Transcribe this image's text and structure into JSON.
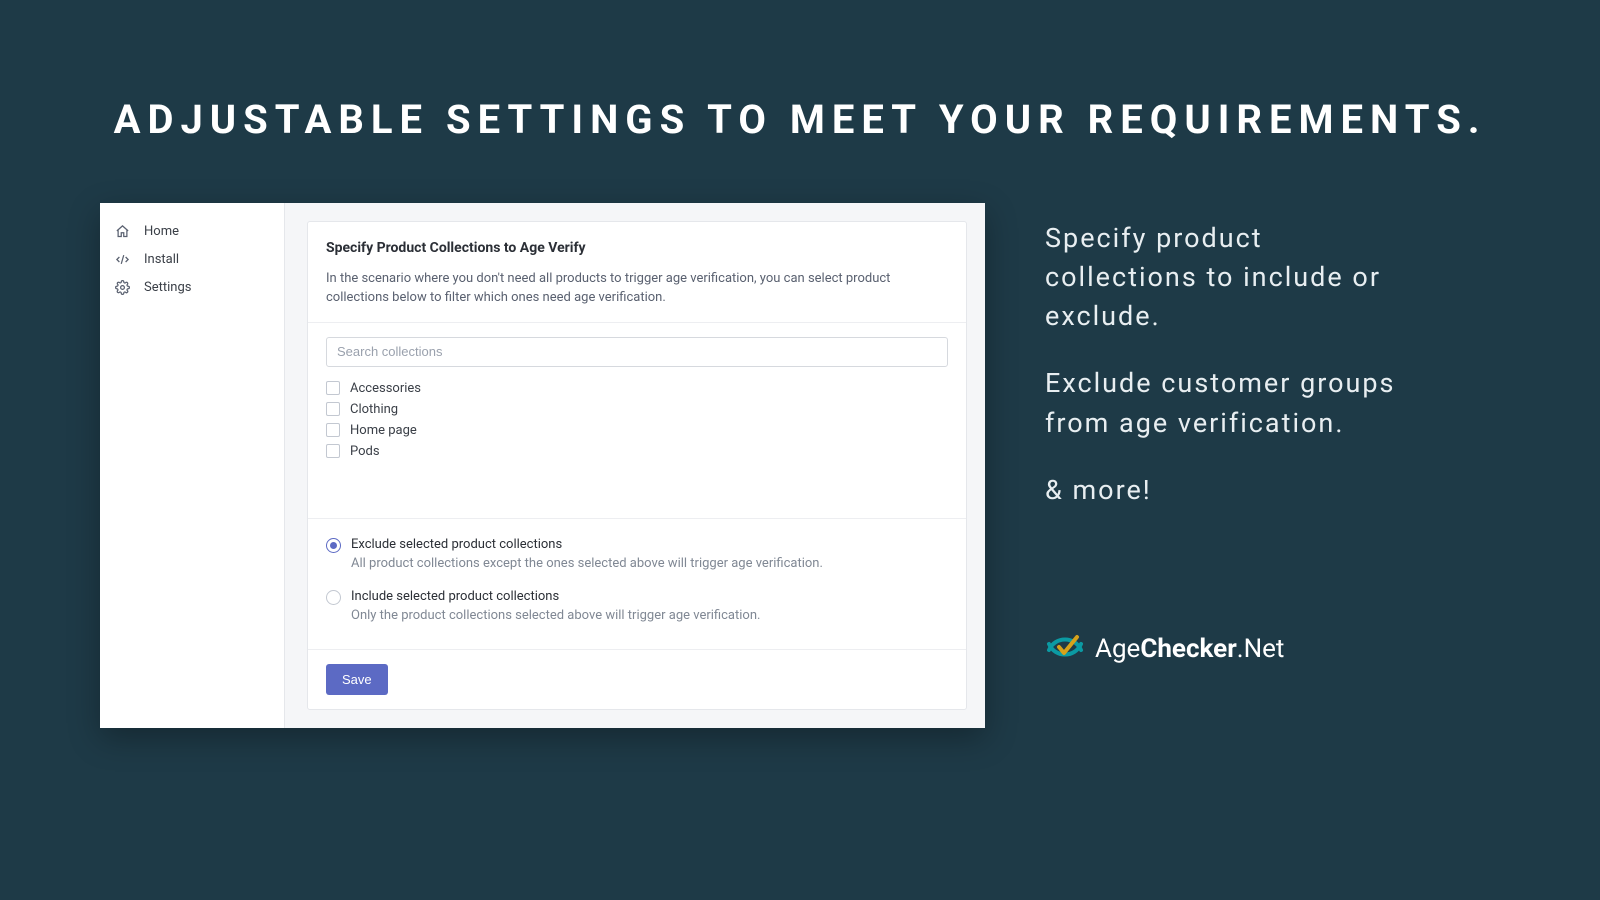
{
  "hero": {
    "title": "ADJUSTABLE SETTINGS TO MEET YOUR REQUIREMENTS."
  },
  "sidebar": {
    "items": [
      {
        "label": "Home"
      },
      {
        "label": "Install"
      },
      {
        "label": "Settings"
      }
    ]
  },
  "panel": {
    "title": "Specify Product Collections to Age Verify",
    "description": "In the scenario where you don't need all products to trigger age verification, you can select product collections below to filter which ones need age verification.",
    "search_placeholder": "Search collections",
    "collections": [
      {
        "label": "Accessories"
      },
      {
        "label": "Clothing"
      },
      {
        "label": "Home page"
      },
      {
        "label": "Pods"
      }
    ],
    "radios": [
      {
        "label": "Exclude selected product collections",
        "help": "All product collections except the ones selected above will trigger age verification.",
        "selected": true
      },
      {
        "label": "Include selected product collections",
        "help": "Only the product collections selected above will trigger age verification.",
        "selected": false
      }
    ],
    "save_label": "Save"
  },
  "promo": {
    "line1": "Specify product collections to include or exclude.",
    "line2": "Exclude customer groups from age verification.",
    "line3": "& more!"
  },
  "brand": {
    "part1": "Age",
    "part2": "Checker",
    "part3": ".Net"
  }
}
